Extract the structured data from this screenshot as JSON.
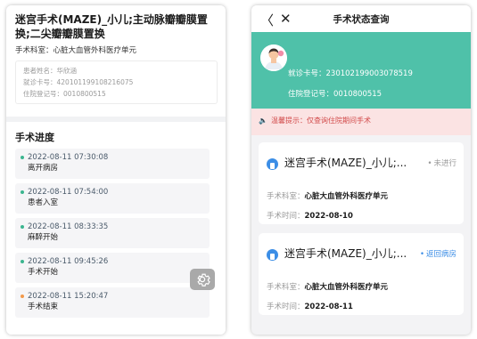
{
  "left": {
    "title": "迷宫手术(MAZE)_小儿;主动脉瓣瓣膜置换;二尖瓣瓣膜置换",
    "dept_label": "手术科室：",
    "dept_value": "心脏大血管外科医疗单元",
    "info": {
      "patient_name_label": "患者姓名：",
      "patient_name_value": "华欣涵",
      "card_label": "就诊卡号：",
      "card_value": "420101199108216075",
      "reg_label": "住院登记号：",
      "reg_value": "0010800515"
    },
    "progress_title": "手术进度",
    "steps": [
      {
        "time": "2022-08-11 07:30:08",
        "event": "离开病房"
      },
      {
        "time": "2022-08-11 07:54:00",
        "event": "患者入室"
      },
      {
        "time": "2022-08-11 08:33:35",
        "event": "麻醉开始"
      },
      {
        "time": "2022-08-11 09:45:26",
        "event": "手术开始"
      },
      {
        "time": "2022-08-11 15:20:47",
        "event": "手术结束"
      }
    ],
    "colors": {
      "dot_done": "#3bb58f",
      "dot_last": "#f2994a"
    },
    "settings_icon": "gear-icon"
  },
  "right": {
    "nav_title": "手术状态查询",
    "back_icon": "chevron-left-icon",
    "close_icon": "close-icon",
    "card_label": "就诊卡号：",
    "card_value": "230102199003078519",
    "reg_label": "住院登记号：",
    "reg_value": "0010800515",
    "tip_label": "温馨提示：",
    "tip_text": "仅查询住院期间手术",
    "items": [
      {
        "title": "迷宫手术(MAZE)_小儿;...",
        "status": "未进行",
        "dept_label": "手术科室：",
        "dept_value": "心脏大血管外科医疗单元",
        "time_label": "手术时间：",
        "time_value": "2022-08-10"
      },
      {
        "title": "迷宫手术(MAZE)_小儿;...",
        "status": "返回病房",
        "dept_label": "手术科室：",
        "dept_value": "心脏大血管外科医疗单元",
        "time_label": "手术时间：",
        "time_value": "2022-08-11"
      }
    ],
    "colors": {
      "banner": "#4fc1a9",
      "tip_bg": "#fbe3e3",
      "tip_text": "#d24b4b",
      "status_pending": "#9a9a9a",
      "status_returned": "#3c8ee6"
    }
  }
}
